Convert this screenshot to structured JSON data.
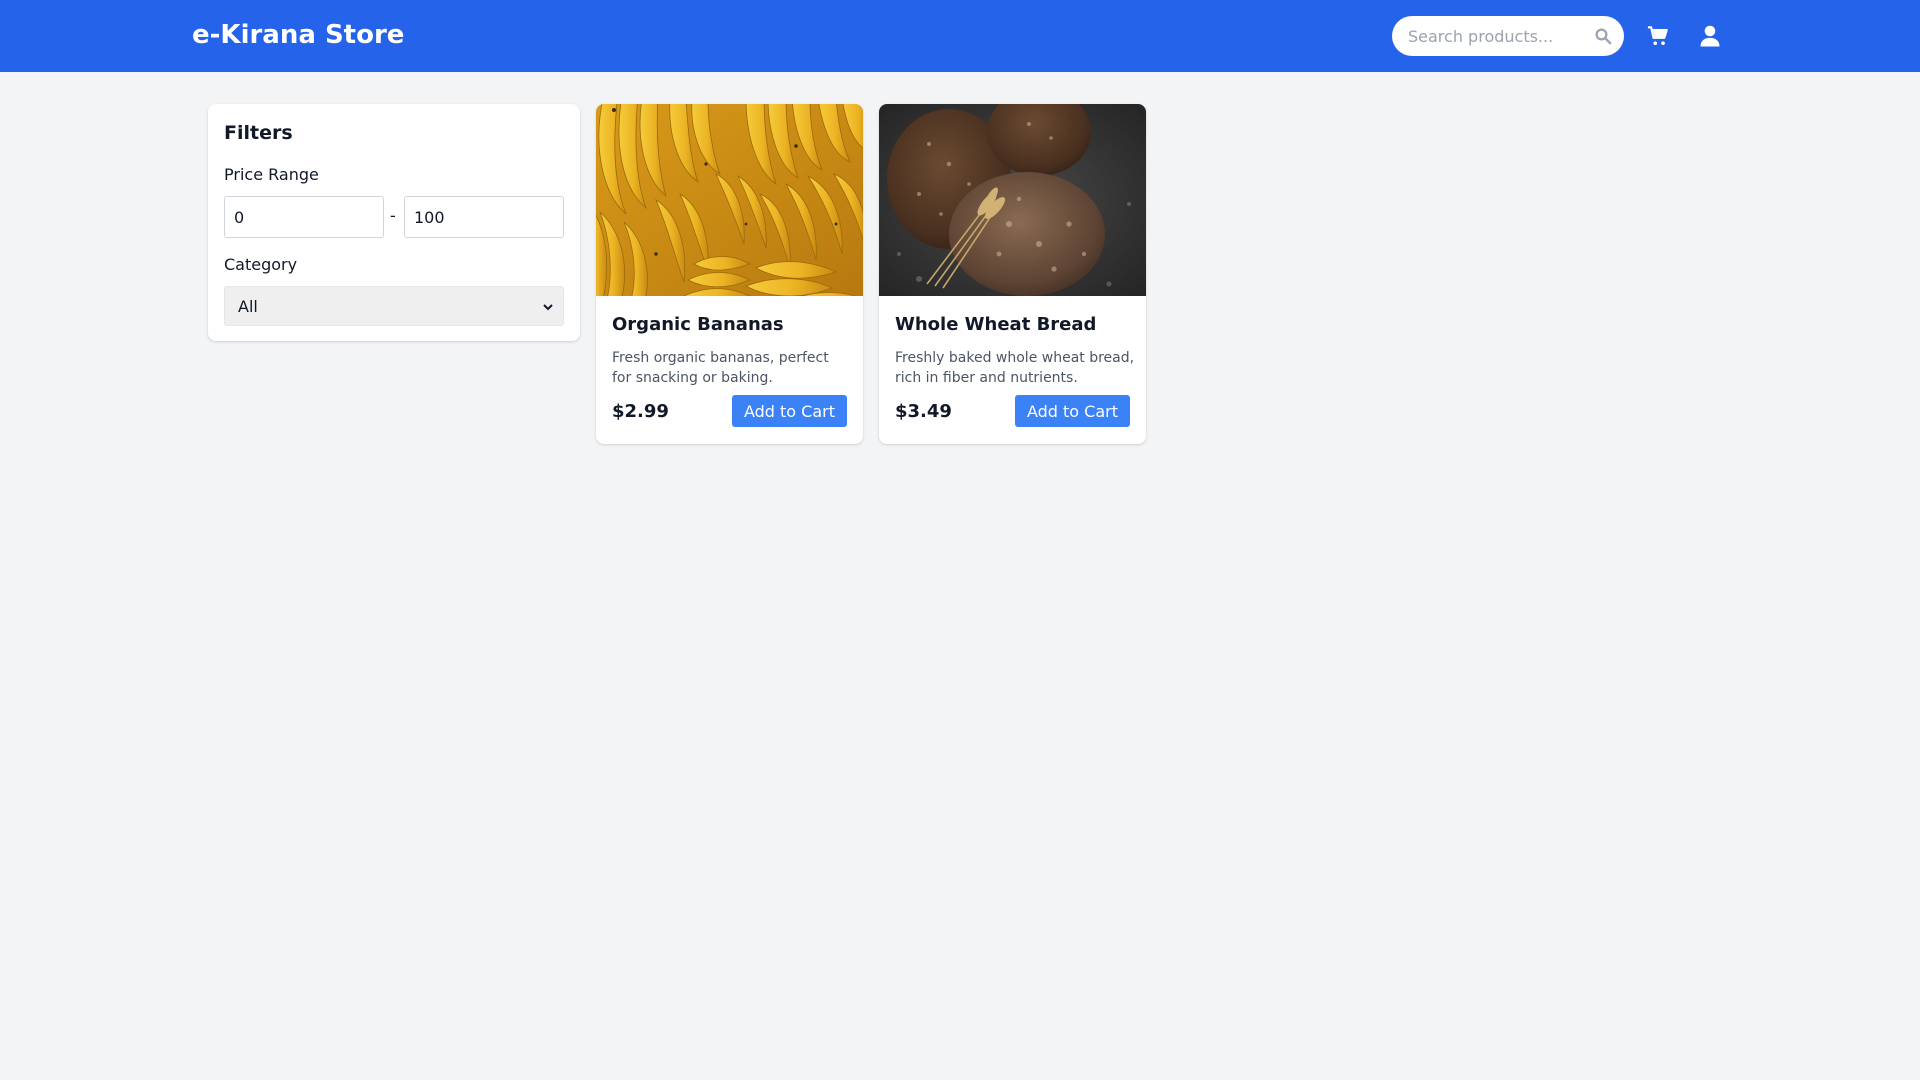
{
  "header": {
    "brand": "e-Kirana Store",
    "search_placeholder": "Search products...",
    "search_value": "",
    "accent_color": "#2563eb"
  },
  "icons": {
    "search": "search-icon",
    "cart": "cart-icon",
    "user": "user-icon",
    "select_arrow": "chevron-down-icon"
  },
  "filters": {
    "title": "Filters",
    "price_label": "Price Range",
    "price_min": "0",
    "price_separator": "-",
    "price_max": "100",
    "category_label": "Category",
    "category_selected": "All"
  },
  "products": [
    {
      "name": "Organic Bananas",
      "description": "Fresh organic bananas, perfect for snacking or baking.",
      "price": "$2.99",
      "button": "Add to Cart"
    },
    {
      "name": "Whole Wheat Bread",
      "description": "Freshly baked whole wheat bread, rich in fiber and nutrients.",
      "price": "$3.49",
      "button": "Add to Cart"
    }
  ],
  "colors": {
    "button": "#3b82f6",
    "background": "#f3f4f6"
  }
}
